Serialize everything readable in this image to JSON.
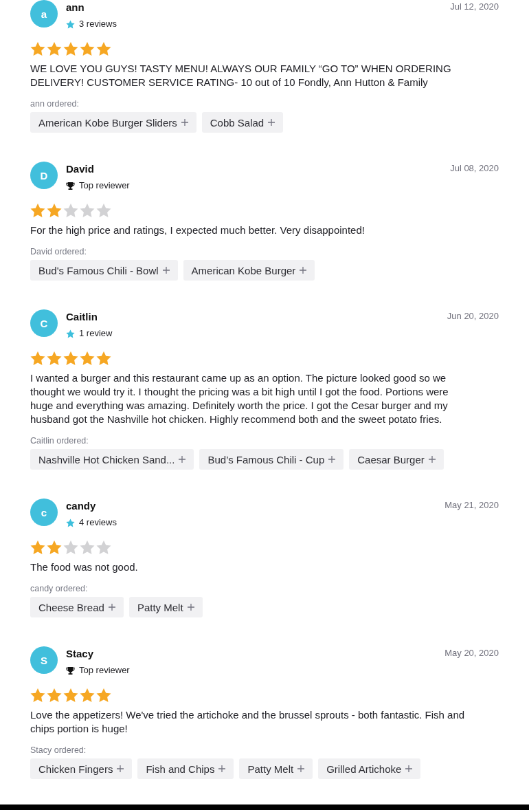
{
  "reviews": [
    {
      "avatar": "a",
      "name": "ann",
      "date": "Jul 12, 2020",
      "badge": {
        "kind": "reviews",
        "label": "3 reviews"
      },
      "stars": 5,
      "text": "WE LOVE YOU GUYS! TASTY MENU! ALWAYS OUR FAMILY “GO TO” WHEN ORDERING DELIVERY! CUSTOMER SERVICE RATING- 10 out of 10 Fondly, Ann Hutton & Family",
      "ordered_label": "ann ordered:",
      "items": [
        "American Kobe Burger Sliders",
        "Cobb Salad"
      ]
    },
    {
      "avatar": "D",
      "name": "David",
      "date": "Jul 08, 2020",
      "badge": {
        "kind": "top_reviewer",
        "label": "Top reviewer"
      },
      "stars": 2,
      "text": "For the high price and ratings, I expected much better. Very disappointed!",
      "ordered_label": "David ordered:",
      "items": [
        "Bud's Famous Chili - Bowl",
        "American Kobe Burger"
      ]
    },
    {
      "avatar": "C",
      "name": "Caitlin",
      "date": "Jun 20, 2020",
      "badge": {
        "kind": "reviews",
        "label": "1 review"
      },
      "stars": 5,
      "text": "I wanted a burger and this restaurant came up as an option. The picture looked good so we thought we would try it. I thought the pricing was a bit high until I got the food. Portions were huge and everything was amazing. Definitely worth the price. I got the Cesar burger and my husband got the Nashville hot chicken. Highly recommend both and the sweet potato fries.",
      "ordered_label": "Caitlin ordered:",
      "items": [
        "Nashville Hot Chicken Sand...",
        "Bud’s Famous Chili - Cup",
        "Caesar Burger"
      ]
    },
    {
      "avatar": "c",
      "name": "candy",
      "date": "May 21, 2020",
      "badge": {
        "kind": "reviews",
        "label": "4 reviews"
      },
      "stars": 2,
      "text": "The food was not good.",
      "ordered_label": "candy ordered:",
      "items": [
        "Cheese Bread",
        "Patty Melt"
      ]
    },
    {
      "avatar": "S",
      "name": "Stacy",
      "date": "May 20, 2020",
      "badge": {
        "kind": "top_reviewer",
        "label": "Top reviewer"
      },
      "stars": 5,
      "text": "Love the appetizers! We've tried the artichoke and the brussel sprouts - both fantastic. Fish and chips portion is huge!",
      "ordered_label": "Stacy ordered:",
      "items": [
        "Chicken Fingers",
        "Fish and Chips",
        "Patty Melt",
        "Grilled Artichoke"
      ]
    }
  ]
}
